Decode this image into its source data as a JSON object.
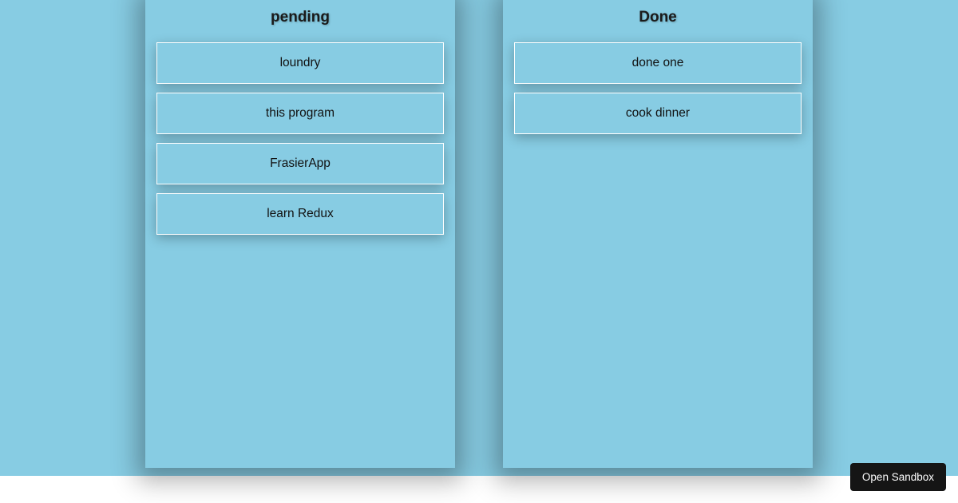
{
  "columns": [
    {
      "title": "pending",
      "cards": [
        {
          "label": "loundry"
        },
        {
          "label": "this program"
        },
        {
          "label": "FrasierApp"
        },
        {
          "label": "learn Redux"
        }
      ]
    },
    {
      "title": "Done",
      "cards": [
        {
          "label": "done one"
        },
        {
          "label": "cook dinner"
        }
      ]
    }
  ],
  "sandbox_button": {
    "label": "Open Sandbox"
  }
}
